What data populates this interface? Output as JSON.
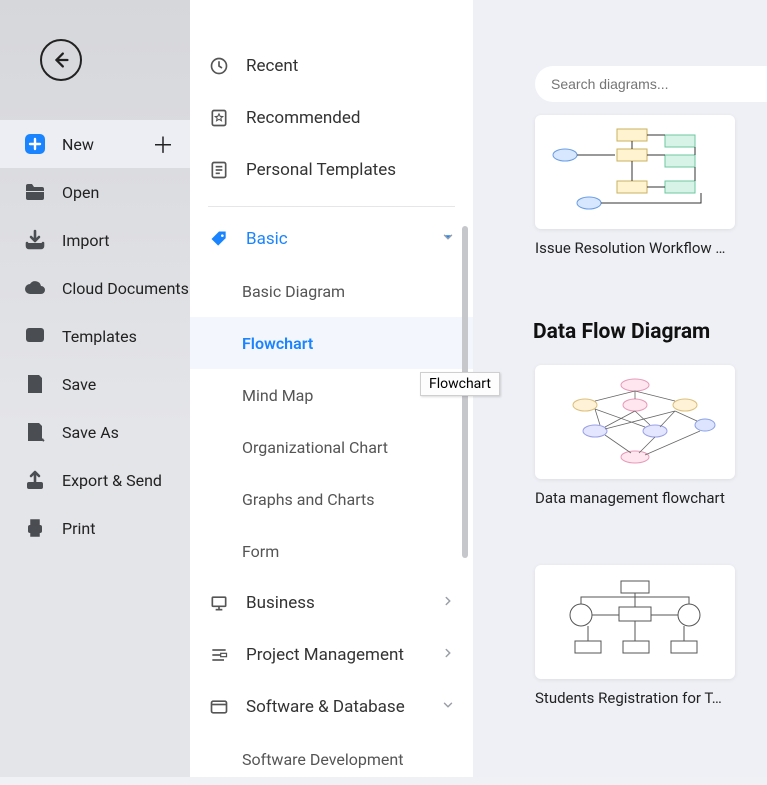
{
  "sidebar": {
    "items": [
      {
        "label": "New",
        "icon": "plus-square-icon",
        "plus": true,
        "selected": true
      },
      {
        "label": "Open",
        "icon": "folder-icon"
      },
      {
        "label": "Import",
        "icon": "download-icon"
      },
      {
        "label": "Cloud Documents",
        "icon": "cloud-icon"
      },
      {
        "label": "Templates",
        "icon": "templates-icon"
      },
      {
        "label": "Save",
        "icon": "save-icon"
      },
      {
        "label": "Save As",
        "icon": "save-as-icon"
      },
      {
        "label": "Export & Send",
        "icon": "export-icon"
      },
      {
        "label": "Print",
        "icon": "print-icon"
      }
    ]
  },
  "categories": {
    "top": [
      {
        "label": "Recent",
        "icon": "clock-icon"
      },
      {
        "label": "Recommended",
        "icon": "star-badge-icon"
      },
      {
        "label": "Personal Templates",
        "icon": "personal-templates-icon"
      }
    ],
    "basic": {
      "label": "Basic",
      "items": [
        {
          "label": "Basic Diagram"
        },
        {
          "label": "Flowchart",
          "selected": true
        },
        {
          "label": "Mind Map"
        },
        {
          "label": "Organizational Chart"
        },
        {
          "label": "Graphs and Charts"
        },
        {
          "label": "Form"
        }
      ]
    },
    "groups": [
      {
        "label": "Business",
        "icon": "presentation-icon",
        "chev": "right"
      },
      {
        "label": "Project Management",
        "icon": "project-icon",
        "chev": "right"
      },
      {
        "label": "Software & Database",
        "icon": "window-icon",
        "chev": "down"
      }
    ],
    "soft_sub": {
      "label": "Software Development"
    }
  },
  "tooltip": "Flowchart",
  "search": {
    "placeholder": "Search diagrams..."
  },
  "content": {
    "template1": "Issue Resolution Workflow …",
    "section": "Data Flow Diagram",
    "template2": "Data management flowchart",
    "template3": "Students Registration for T…"
  }
}
